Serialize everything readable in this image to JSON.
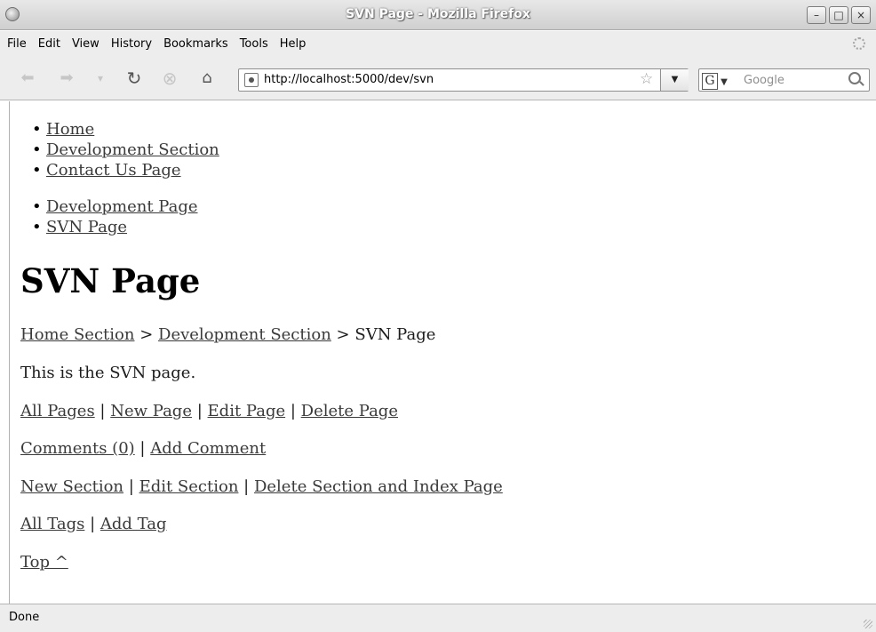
{
  "window": {
    "title": "SVN Page - Mozilla Firefox",
    "controls": {
      "minimize": "–",
      "maximize": "□",
      "close": "×"
    }
  },
  "menubar": {
    "items": [
      "File",
      "Edit",
      "View",
      "History",
      "Bookmarks",
      "Tools",
      "Help"
    ]
  },
  "toolbar": {
    "url": "http://localhost:5000/dev/svn",
    "search_engine": "G",
    "search_placeholder": "Google"
  },
  "page": {
    "nav_main": [
      "Home",
      "Development Section",
      "Contact Us Page"
    ],
    "nav_sub": [
      "Development Page",
      "SVN Page"
    ],
    "title": "SVN Page",
    "breadcrumb": {
      "home": "Home Section",
      "separator": ">",
      "section": "Development Section",
      "current": "SVN Page"
    },
    "body_text": "This is the SVN page.",
    "page_actions": [
      "All Pages",
      "New Page",
      "Edit Page",
      "Delete Page"
    ],
    "comment_actions": [
      "Comments (0)",
      "Add Comment"
    ],
    "section_actions": [
      "New Section",
      "Edit Section",
      "Delete Section and Index Page"
    ],
    "tag_actions": [
      "All Tags",
      "Add Tag"
    ],
    "top_link": "Top ^",
    "separator": "|"
  },
  "statusbar": {
    "text": "Done"
  }
}
